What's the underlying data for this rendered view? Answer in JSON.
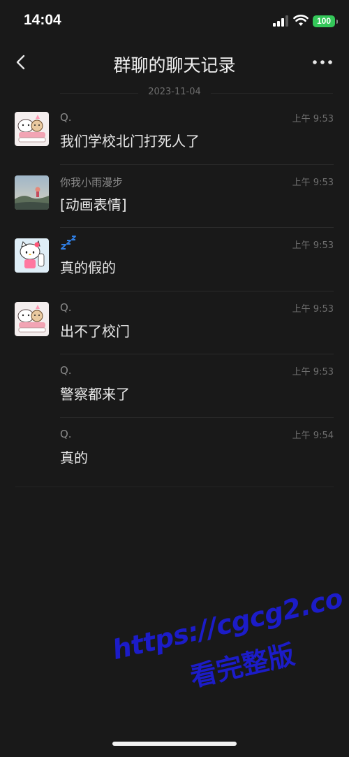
{
  "status_bar": {
    "time": "14:04",
    "battery": "100"
  },
  "nav": {
    "title": "群聊的聊天记录",
    "back_icon": "chevron-left-icon",
    "more_icon": "ellipsis-icon"
  },
  "date_separator": "2023-11-04",
  "messages": [
    {
      "sender": "Q.",
      "time": "上午 9:53",
      "text": "我们学校北门打死人了",
      "avatar": "cat-bear-avatar"
    },
    {
      "sender": "你我小雨漫步",
      "time": "上午 9:53",
      "text": "[动画表情]",
      "avatar": "landscape-avatar"
    },
    {
      "sender": "",
      "time": "上午 9:53",
      "text": "真的假的",
      "avatar": "hello-kitty-avatar",
      "sender_icon": "sleep-zzz-icon"
    },
    {
      "sender": "Q.",
      "time": "上午 9:53",
      "text": "出不了校门",
      "avatar": "cat-bear-avatar"
    },
    {
      "sender": "Q.",
      "time": "上午 9:53",
      "text": "警察都来了"
    },
    {
      "sender": "Q.",
      "time": "上午 9:54",
      "text": "真的"
    }
  ],
  "watermark": {
    "url": "https://cgcg2.co",
    "text": "看完整版"
  },
  "colors": {
    "background": "#191919",
    "battery": "#34c759",
    "watermark": "#1c1cc8"
  }
}
